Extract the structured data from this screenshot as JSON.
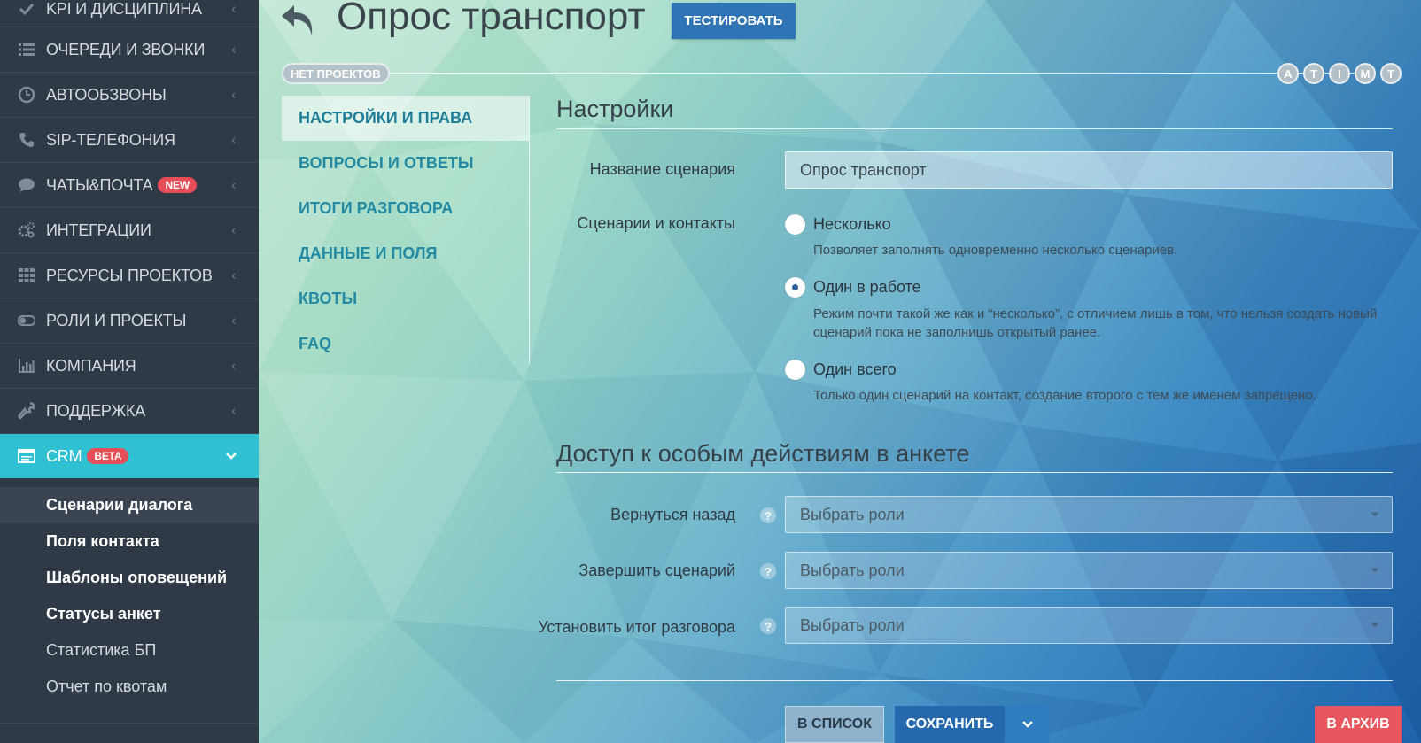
{
  "sidebar": {
    "items": [
      {
        "label": "KPI И ДИСЦИПЛИНА",
        "icon": "check-icon"
      },
      {
        "label": "ОЧЕРЕДИ И ЗВОНКИ",
        "icon": "list-icon"
      },
      {
        "label": "АВТООБЗВОНЫ",
        "icon": "clock-icon"
      },
      {
        "label": "SIP-ТЕЛЕФОНИЯ",
        "icon": "phone-icon"
      },
      {
        "label": "ЧАТЫ&ПОЧТА",
        "icon": "chat-icon",
        "badge": "NEW"
      },
      {
        "label": "ИНТЕГРАЦИИ",
        "icon": "gears-icon"
      },
      {
        "label": "РЕСУРСЫ ПРОЕКТОВ",
        "icon": "grid-icon"
      },
      {
        "label": "РОЛИ И ПРОЕКТЫ",
        "icon": "toggle-icon"
      },
      {
        "label": "КОМПАНИЯ",
        "icon": "bar-chart-icon"
      },
      {
        "label": "ПОДДЕРЖКА",
        "icon": "wrench-icon"
      }
    ],
    "active": {
      "label": "CRM",
      "icon": "card-icon",
      "badge": "BETA"
    },
    "submenu": [
      "Сценарии диалога",
      "Поля контакта",
      "Шаблоны оповещений",
      "Статусы анкет",
      "Статистика БП",
      "Отчет по квотам"
    ]
  },
  "header": {
    "title": "Опрос транспорт",
    "test_button": "ТЕСТИРОВАТЬ",
    "projects_badge": "НЕТ ПРОЕКТОВ",
    "role_dots": [
      "A",
      "T",
      "I",
      "M",
      "T"
    ]
  },
  "tabs": [
    "НАСТРОЙКИ И ПРАВА",
    "ВОПРОСЫ И ОТВЕТЫ",
    "ИТОГИ РАЗГОВОРА",
    "ДАННЫЕ И ПОЛЯ",
    "КВОТЫ",
    "FAQ"
  ],
  "settings": {
    "title": "Настройки",
    "name_label": "Название сценария",
    "name_value": "Опрос транспорт",
    "contacts_label": "Сценарии и контакты",
    "options": [
      {
        "label": "Несколько",
        "desc": "Позволяет заполнять одновременно несколько сценариев.",
        "checked": false
      },
      {
        "label": "Один в работе",
        "desc": "Режим почти такой же как и “несколько”, с отличием лишь в том, что нельзя создать новый сценарий пока не заполнишь открытый ранее.",
        "checked": true
      },
      {
        "label": "Один всего",
        "desc": "Только один сценарий на контакт, создание второго с тем же именем запрещено.",
        "checked": false
      }
    ]
  },
  "access": {
    "title": "Доступ к особым действиям в анкете",
    "rows": [
      {
        "label": "Вернуться назад",
        "placeholder": "Выбрать роли"
      },
      {
        "label": "Завершить сценарий",
        "placeholder": "Выбрать роли"
      },
      {
        "label": "Установить итог разговора",
        "placeholder": "Выбрать роли"
      }
    ],
    "help_glyph": "?"
  },
  "actions": {
    "list_button": "В СПИСОК",
    "save_button": "СОХРАНИТЬ",
    "archive_button": "В АРХИВ"
  },
  "colors": {
    "sidebar_bg": "#2f3a46",
    "active_item": "#2fc0d2",
    "badge_red": "#e54e57",
    "primary_blue": "#2f75b5",
    "tab_text": "#228aa3",
    "archive_red": "#e8565e"
  }
}
